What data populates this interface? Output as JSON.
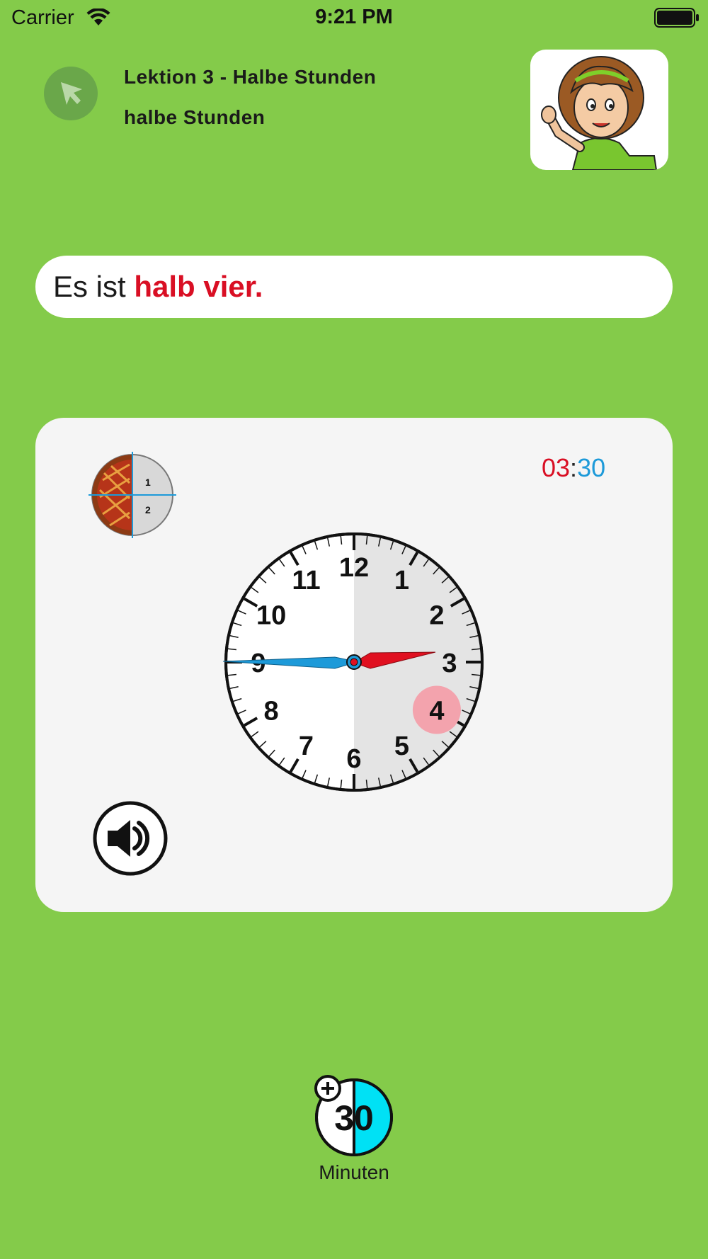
{
  "status_bar": {
    "carrier": "Carrier",
    "time": "9:21 PM"
  },
  "header": {
    "title": "Lektion 3 - Halbe Stunden",
    "subtitle": "halbe Stunden"
  },
  "sentence": {
    "prefix": "Es ist ",
    "answer": "halb vier."
  },
  "clock": {
    "digital_hours": "03",
    "digital_separator": ":",
    "digital_minutes": "30",
    "numbers": [
      "12",
      "1",
      "2",
      "3",
      "4",
      "5",
      "6",
      "7",
      "8",
      "9",
      "10",
      "11"
    ],
    "highlighted_hour": "4",
    "pie_labels": [
      "1",
      "2"
    ]
  },
  "minutes_control": {
    "value": "30",
    "label": "Minuten"
  },
  "colors": {
    "background": "#84cb4a",
    "hour_accent": "#d90f24",
    "minute_accent": "#1d9ad9",
    "minutes_fill": "#00e1f5",
    "highlight": "#f3a3ad"
  }
}
